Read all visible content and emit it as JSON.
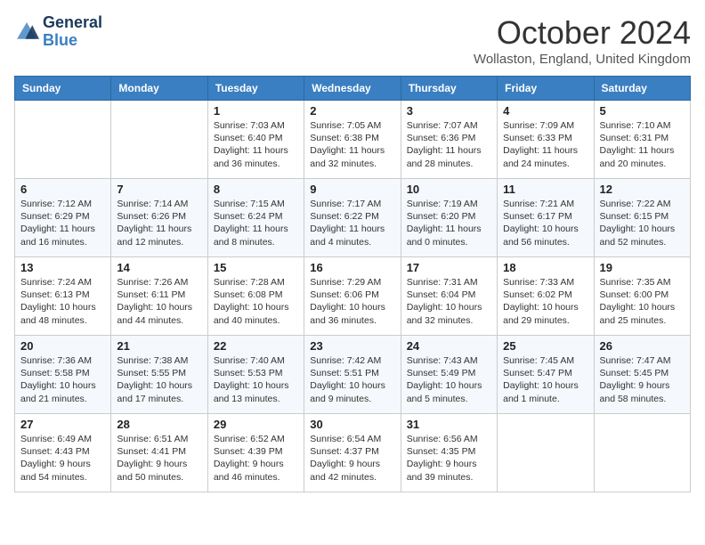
{
  "header": {
    "logo_line1": "General",
    "logo_line2": "Blue",
    "month": "October 2024",
    "location": "Wollaston, England, United Kingdom"
  },
  "weekdays": [
    "Sunday",
    "Monday",
    "Tuesday",
    "Wednesday",
    "Thursday",
    "Friday",
    "Saturday"
  ],
  "weeks": [
    [
      null,
      null,
      {
        "day": 1,
        "sunrise": "7:03 AM",
        "sunset": "6:40 PM",
        "daylight": "11 hours and 36 minutes."
      },
      {
        "day": 2,
        "sunrise": "7:05 AM",
        "sunset": "6:38 PM",
        "daylight": "11 hours and 32 minutes."
      },
      {
        "day": 3,
        "sunrise": "7:07 AM",
        "sunset": "6:36 PM",
        "daylight": "11 hours and 28 minutes."
      },
      {
        "day": 4,
        "sunrise": "7:09 AM",
        "sunset": "6:33 PM",
        "daylight": "11 hours and 24 minutes."
      },
      {
        "day": 5,
        "sunrise": "7:10 AM",
        "sunset": "6:31 PM",
        "daylight": "11 hours and 20 minutes."
      }
    ],
    [
      {
        "day": 6,
        "sunrise": "7:12 AM",
        "sunset": "6:29 PM",
        "daylight": "11 hours and 16 minutes."
      },
      {
        "day": 7,
        "sunrise": "7:14 AM",
        "sunset": "6:26 PM",
        "daylight": "11 hours and 12 minutes."
      },
      {
        "day": 8,
        "sunrise": "7:15 AM",
        "sunset": "6:24 PM",
        "daylight": "11 hours and 8 minutes."
      },
      {
        "day": 9,
        "sunrise": "7:17 AM",
        "sunset": "6:22 PM",
        "daylight": "11 hours and 4 minutes."
      },
      {
        "day": 10,
        "sunrise": "7:19 AM",
        "sunset": "6:20 PM",
        "daylight": "11 hours and 0 minutes."
      },
      {
        "day": 11,
        "sunrise": "7:21 AM",
        "sunset": "6:17 PM",
        "daylight": "10 hours and 56 minutes."
      },
      {
        "day": 12,
        "sunrise": "7:22 AM",
        "sunset": "6:15 PM",
        "daylight": "10 hours and 52 minutes."
      }
    ],
    [
      {
        "day": 13,
        "sunrise": "7:24 AM",
        "sunset": "6:13 PM",
        "daylight": "10 hours and 48 minutes."
      },
      {
        "day": 14,
        "sunrise": "7:26 AM",
        "sunset": "6:11 PM",
        "daylight": "10 hours and 44 minutes."
      },
      {
        "day": 15,
        "sunrise": "7:28 AM",
        "sunset": "6:08 PM",
        "daylight": "10 hours and 40 minutes."
      },
      {
        "day": 16,
        "sunrise": "7:29 AM",
        "sunset": "6:06 PM",
        "daylight": "10 hours and 36 minutes."
      },
      {
        "day": 17,
        "sunrise": "7:31 AM",
        "sunset": "6:04 PM",
        "daylight": "10 hours and 32 minutes."
      },
      {
        "day": 18,
        "sunrise": "7:33 AM",
        "sunset": "6:02 PM",
        "daylight": "10 hours and 29 minutes."
      },
      {
        "day": 19,
        "sunrise": "7:35 AM",
        "sunset": "6:00 PM",
        "daylight": "10 hours and 25 minutes."
      }
    ],
    [
      {
        "day": 20,
        "sunrise": "7:36 AM",
        "sunset": "5:58 PM",
        "daylight": "10 hours and 21 minutes."
      },
      {
        "day": 21,
        "sunrise": "7:38 AM",
        "sunset": "5:55 PM",
        "daylight": "10 hours and 17 minutes."
      },
      {
        "day": 22,
        "sunrise": "7:40 AM",
        "sunset": "5:53 PM",
        "daylight": "10 hours and 13 minutes."
      },
      {
        "day": 23,
        "sunrise": "7:42 AM",
        "sunset": "5:51 PM",
        "daylight": "10 hours and 9 minutes."
      },
      {
        "day": 24,
        "sunrise": "7:43 AM",
        "sunset": "5:49 PM",
        "daylight": "10 hours and 5 minutes."
      },
      {
        "day": 25,
        "sunrise": "7:45 AM",
        "sunset": "5:47 PM",
        "daylight": "10 hours and 1 minute."
      },
      {
        "day": 26,
        "sunrise": "7:47 AM",
        "sunset": "5:45 PM",
        "daylight": "9 hours and 58 minutes."
      }
    ],
    [
      {
        "day": 27,
        "sunrise": "6:49 AM",
        "sunset": "4:43 PM",
        "daylight": "9 hours and 54 minutes."
      },
      {
        "day": 28,
        "sunrise": "6:51 AM",
        "sunset": "4:41 PM",
        "daylight": "9 hours and 50 minutes."
      },
      {
        "day": 29,
        "sunrise": "6:52 AM",
        "sunset": "4:39 PM",
        "daylight": "9 hours and 46 minutes."
      },
      {
        "day": 30,
        "sunrise": "6:54 AM",
        "sunset": "4:37 PM",
        "daylight": "9 hours and 42 minutes."
      },
      {
        "day": 31,
        "sunrise": "6:56 AM",
        "sunset": "4:35 PM",
        "daylight": "9 hours and 39 minutes."
      },
      null,
      null
    ]
  ]
}
